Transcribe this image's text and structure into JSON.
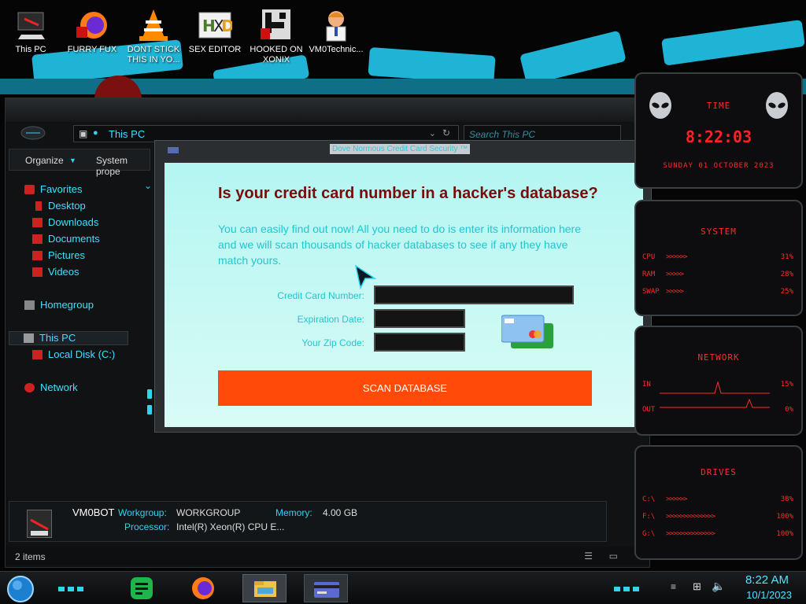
{
  "desktop_icons": [
    {
      "label": "This PC"
    },
    {
      "label": "FURRY FUX"
    },
    {
      "label": "DONT STICK THIS IN YO..."
    },
    {
      "label": "SEX EDITOR"
    },
    {
      "label": "HOOKED ON XONIX"
    },
    {
      "label": "VM0Technic..."
    }
  ],
  "explorer": {
    "address": "This PC",
    "search_placeholder": "Search This PC",
    "toolbar": {
      "organize": "Organize",
      "system_properties": "System prope"
    },
    "nav": {
      "favorites": "Favorites",
      "desktop": "Desktop",
      "downloads": "Downloads",
      "documents": "Documents",
      "pictures": "Pictures",
      "videos": "Videos",
      "homegroup": "Homegroup",
      "this_pc": "This PC",
      "local_disk": "Local Disk (C:)",
      "network": "Network"
    },
    "details": {
      "pc_name": "VM0BOT",
      "workgroup_label": "Workgroup:",
      "workgroup_value": "WORKGROUP",
      "memory_label": "Memory:",
      "memory_value": "4.00 GB",
      "processor_label": "Processor:",
      "processor_value": "Intel(R) Xeon(R) CPU E..."
    },
    "status": "2 items"
  },
  "popup": {
    "title": "Dove Normous Credit Card Security ™",
    "heading": "Is your credit card number in a hacker's database?",
    "body": "You can easily find out now! All you need to do is enter its information here and we will scan thousands of hacker databases to see if any they have match yours.",
    "fields": {
      "card_label": "Credit Card Number:",
      "expiry_label": "Expiration Date:",
      "zip_label": "Your Zip Code:",
      "card_value": "",
      "expiry_value": "",
      "zip_value": ""
    },
    "button_label": "SCAN DATABASE"
  },
  "gadgets": {
    "time": {
      "title": "TIME",
      "clock": "8:22:03",
      "date": "SUNDAY 01 OCTOBER 2023"
    },
    "system": {
      "title": "SYSTEM",
      "rows": [
        {
          "label": "CPU",
          "value": "31%"
        },
        {
          "label": "RAM",
          "value": "28%"
        },
        {
          "label": "SWAP",
          "value": "25%"
        }
      ]
    },
    "network": {
      "title": "NETWORK",
      "rows": [
        {
          "label": "IN",
          "value": "15%"
        },
        {
          "label": "OUT",
          "value": "0%"
        }
      ]
    },
    "drives": {
      "title": "DRIVES",
      "rows": [
        {
          "label": "C:\\",
          "value": "38%"
        },
        {
          "label": "F:\\",
          "value": "100%"
        },
        {
          "label": "G:\\",
          "value": "100%"
        }
      ]
    }
  },
  "taskbar": {
    "time": "8:22 AM",
    "date": "10/1/2023"
  },
  "colors": {
    "accent_cyan": "#2fd4ef",
    "alert_red": "#ff2a2a",
    "scan_button": "#ff4a0a",
    "heading": "#7a0b0b"
  }
}
